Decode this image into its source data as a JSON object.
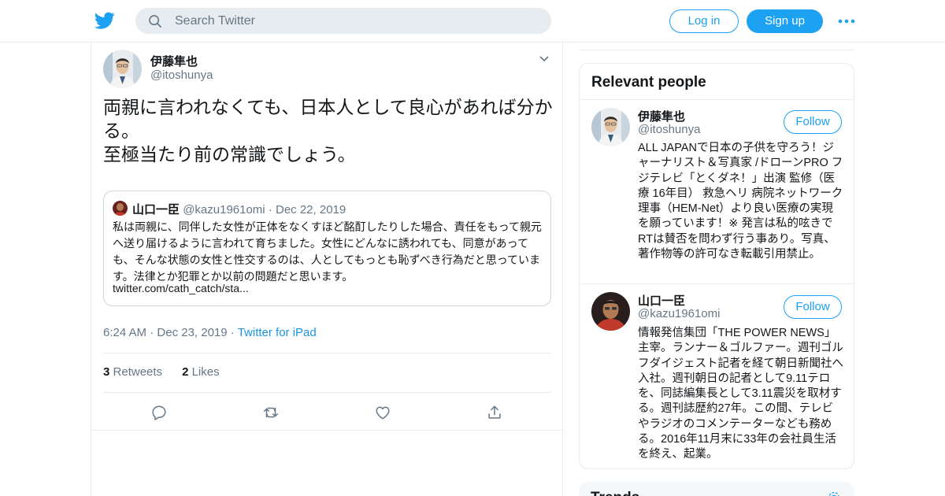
{
  "header": {
    "logo_icon": "twitter-bird-icon",
    "search_placeholder": "Search Twitter",
    "login_label": "Log in",
    "signup_label": "Sign up",
    "more_icon": "more-dots-icon",
    "accent": "#1da1f2"
  },
  "tweet": {
    "author_name": "伊藤隼也",
    "author_handle": "@itoshunya",
    "text": "両親に言われなくても、日本人として良心があれば分かる。\n至極当たり前の常識でしょう。",
    "quoted": {
      "author_name": "山口一臣",
      "author_handle": "@kazu1961omi",
      "separator": "·",
      "date": "Dec 22, 2019",
      "text": "私は両親に、同伴した女性が正体をなくすほど酩酊したりした場合、責任をもって親元へ送り届けるように言われて育ちました。女性にどんなに誘われても、同意があっても、そんな状態の女性と性交するのは、人としてもっとも恥ずべき行為だと思っています。法律とか犯罪とか以前の問題だと思います。",
      "link": "twitter.com/cath_catch/sta..."
    },
    "time": "6:24 AM",
    "separator": "·",
    "date": "Dec 23, 2019",
    "source": "Twitter for iPad",
    "retweets_count": "3",
    "retweets_label": "Retweets",
    "likes_count": "2",
    "likes_label": "Likes",
    "actions": [
      "reply-icon",
      "retweet-icon",
      "like-icon",
      "share-icon"
    ]
  },
  "sidebar": {
    "relevant_title": "Relevant people",
    "people": [
      {
        "name": "伊藤隼也",
        "handle": "@itoshunya",
        "follow_label": "Follow",
        "bio": "ALL JAPANで日本の子供を守ろう！ジャーナリスト＆写真家 /ドローンPRO フジテレビ「とくダネ！」出演 監修（医療 16年目） 救急ヘリ 病院ネットワーク理事（HEM-Net）より良い医療の実現を願っています！※ 発言は私的呟きでRTは賛否を問わず行う事あり。写真、著作物等の許可なき転載引用禁止。"
      },
      {
        "name": "山口一臣",
        "handle": "@kazu1961omi",
        "follow_label": "Follow",
        "bio": "情報発信集団「THE POWER NEWS」主宰。ランナー＆ゴルファー。週刊ゴルフダイジェスト記者を経て朝日新聞社へ入社。週刊朝日の記者として9.11テロを、同誌編集長として3.11震災を取材する。週刊誌歴約27年。この間、テレビやラジオのコメンテーターなども務める。2016年11月末に33年の会社員生活を終え、起業。"
      }
    ],
    "trends_title": "Trends",
    "trends_icon": "settings-gear-icon"
  }
}
